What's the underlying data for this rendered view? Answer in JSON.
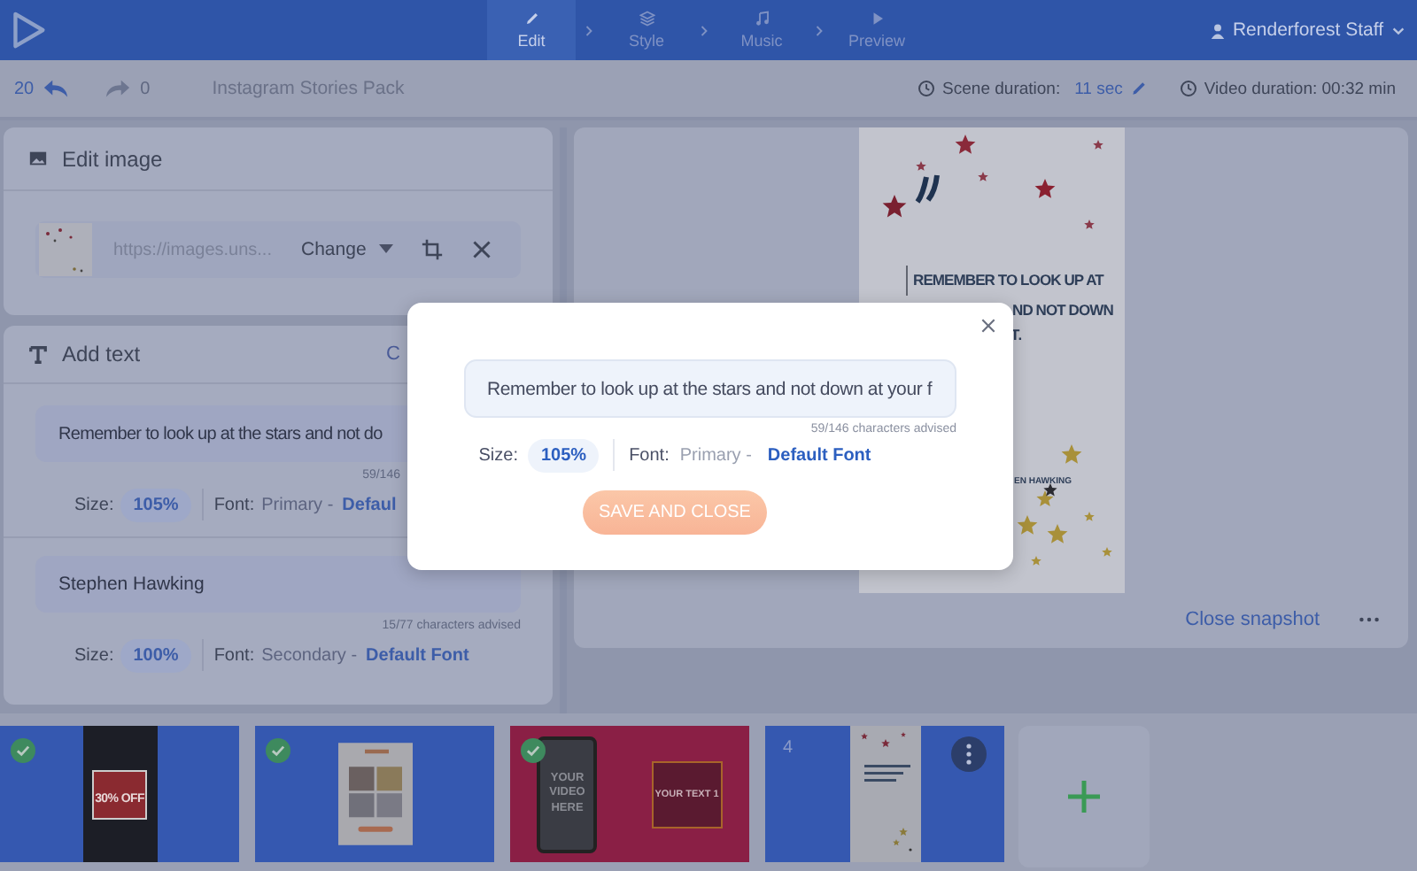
{
  "topbar": {
    "steps": [
      {
        "label": "Edit",
        "kind": "edit",
        "selected": true
      },
      {
        "label": "Style",
        "kind": "style",
        "selected": false
      },
      {
        "label": "Music",
        "kind": "music",
        "selected": false
      },
      {
        "label": "Preview",
        "kind": "preview",
        "selected": false
      }
    ],
    "user": "Renderforest Staff"
  },
  "toolbar": {
    "undo_count": "20",
    "redo_count": "0",
    "project": "Instagram Stories Pack",
    "scene_label": "Scene duration:",
    "scene_value": "11 sec",
    "video_duration": "Video duration: 00:32 min"
  },
  "edit_image": {
    "title": "Edit image",
    "url": "https://images.uns...",
    "change": "Change"
  },
  "add_text": {
    "title": "Add text",
    "action": "C",
    "items": [
      {
        "value": "Remember to look up at the stars and not do",
        "counter": "59/146",
        "size_label": "Size:",
        "size": "105%",
        "font_label": "Font:",
        "font_role": "Primary -",
        "font_name": "Defaul"
      },
      {
        "value": "Stephen Hawking",
        "counter": "15/77 characters advised",
        "size_label": "Size:",
        "size": "100%",
        "font_label": "Font:",
        "font_role": "Secondary -",
        "font_name": "Default Font"
      }
    ]
  },
  "preview": {
    "lines": [
      "REMEMBER TO LOOK UP AT",
      "ND NOT DOWN",
      "T.",
      "EN HAWKING"
    ],
    "close": "Close snapshot"
  },
  "scenes": [
    {
      "kind": "sale",
      "checked": true,
      "selected": false,
      "texts": [
        "30% OFF"
      ]
    },
    {
      "kind": "collage",
      "checked": true,
      "selected": false
    },
    {
      "kind": "video",
      "checked": true,
      "selected": false,
      "texts": [
        "YOUR VIDEO HERE",
        "YOUR TEXT 1"
      ]
    },
    {
      "kind": "quote",
      "checked": false,
      "selected": true,
      "number": "4"
    }
  ],
  "modal": {
    "value": "Remember to look up at the stars and not down at your f",
    "counter": "59/146 characters advised",
    "size_label": "Size:",
    "size": "105%",
    "font_label": "Font:",
    "font_role": "Primary -",
    "font_name": "Default Font",
    "save": "SAVE AND CLOSE"
  }
}
